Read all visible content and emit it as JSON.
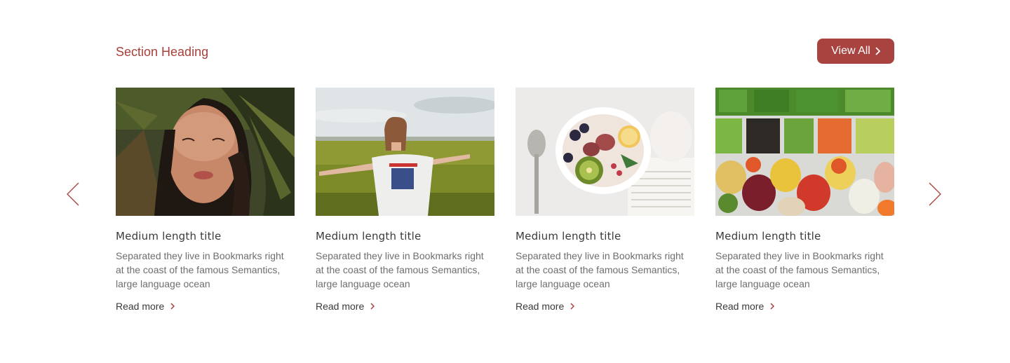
{
  "section": {
    "heading": "Section Heading",
    "view_all_label": "View All"
  },
  "colors": {
    "accent": "#a8433f",
    "heading": "#a8403c",
    "text": "#3a3a3a",
    "muted": "#6e6e6e"
  },
  "cards": [
    {
      "title": "Medium length title",
      "description": "Separated they live in Bookmarks right at the coast of the famous Semantics, large language ocean",
      "link": "Read more"
    },
    {
      "title": "Medium length title",
      "description": "Separated they live in Bookmarks right at the coast of the famous Semantics, large language ocean",
      "link": "Read more"
    },
    {
      "title": "Medium length title",
      "description": "Separated they live in Bookmarks right at the coast of the famous Semantics, large language ocean",
      "link": "Read more"
    },
    {
      "title": "Medium length title",
      "description": "Separated they live in Bookmarks right at the coast of the famous Semantics, large language ocean",
      "link": "Read more"
    }
  ]
}
